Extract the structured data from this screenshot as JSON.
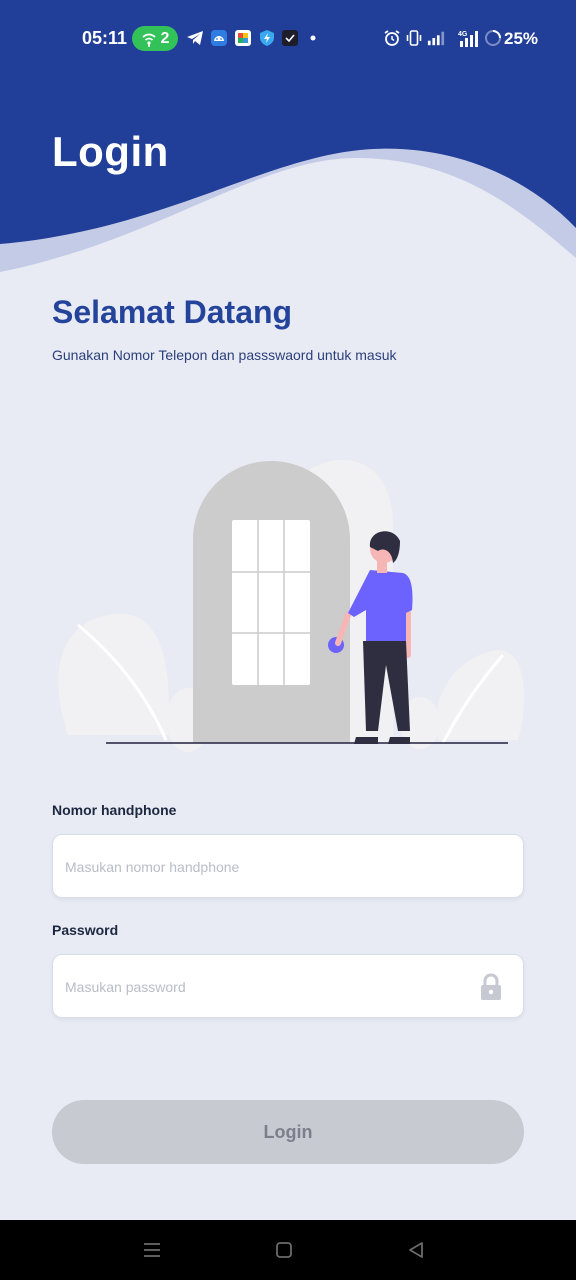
{
  "status_bar": {
    "time": "05:11",
    "wifi_count": "2",
    "battery": "25%",
    "icons": [
      "telegram-icon",
      "android-icon",
      "app-icon",
      "shield-icon",
      "check-icon",
      "dot-icon",
      "alarm-icon",
      "vibrate-icon",
      "signal-icon",
      "signal-4g-icon",
      "battery-ring-icon"
    ]
  },
  "header": {
    "title": "Login",
    "color": "#213f98"
  },
  "welcome": {
    "heading": "Selamat Datang",
    "subtitle": "Gunakan Nomor Telepon dan passswaord untuk masuk"
  },
  "form": {
    "phone": {
      "label": "Nomor handphone",
      "placeholder": "Masukan nomor handphone",
      "value": ""
    },
    "password": {
      "label": "Password",
      "placeholder": "Masukan password",
      "value": ""
    },
    "submit_label": "Login"
  },
  "colors": {
    "primary": "#213f98",
    "background": "#e8ebf4",
    "button_disabled": "#c8cad2",
    "accent_person": "#6c63ff"
  }
}
